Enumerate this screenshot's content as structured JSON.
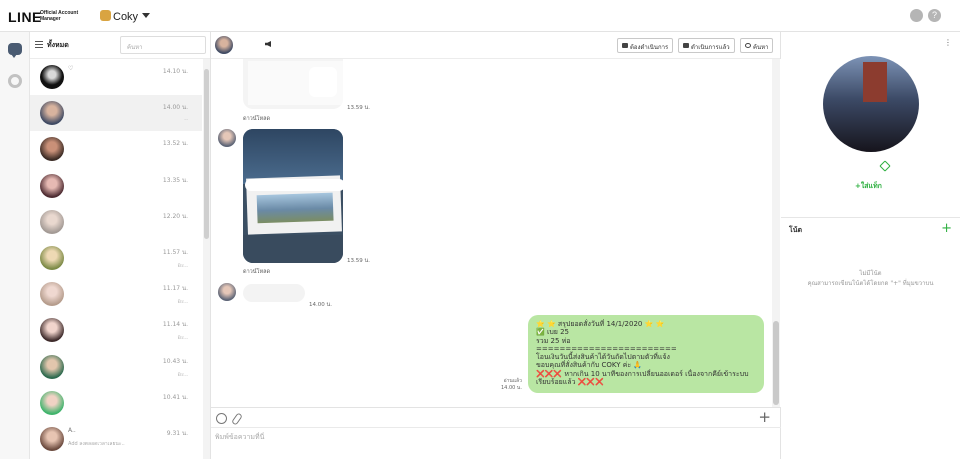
{
  "topbar": {
    "logo": "LINE",
    "logo_sub": "Official Account Manager",
    "account_name": "Coky",
    "user_icon": "user-icon",
    "help_icon": "help-icon",
    "help_glyph": "?"
  },
  "rail": {
    "chat_icon": "chat-icon",
    "settings_icon": "gear-icon"
  },
  "chat_list": {
    "filter_label": "ทั้งหมด",
    "search_placeholder": "ค้นหา",
    "items": [
      {
        "time": "14.10 น.",
        "name": "♡",
        "preview": ""
      },
      {
        "time": "14.00 น.",
        "name": "",
        "preview": ".."
      },
      {
        "time": "13.52 น.",
        "name": "",
        "preview": ""
      },
      {
        "time": "13.35 น.",
        "name": "",
        "preview": ""
      },
      {
        "time": "12.20 น.",
        "name": "",
        "preview": ""
      },
      {
        "time": "11.57 น.",
        "name": "",
        "preview": "อะ.."
      },
      {
        "time": "11.17 น.",
        "name": "",
        "preview": "อะ.."
      },
      {
        "time": "11.14 น.",
        "name": "",
        "preview": "อะ.."
      },
      {
        "time": "10.43 น.",
        "name": "",
        "preview": "อะ.."
      },
      {
        "time": "10.41 น.",
        "name": "",
        "preview": ""
      },
      {
        "time": "9.31 น.",
        "name": "A..",
        "preview": "Add ลงตลอดเวลาเลยนะ.."
      }
    ]
  },
  "chat": {
    "buttons": {
      "todo": "ต้องดำเนินการ",
      "done": "ดำเนินการแล้ว",
      "search": "ค้นหา"
    },
    "messages": {
      "img1_time": "13.59 น.",
      "img1_caption": "ดาวน์โหลด",
      "img2_time": "13.59 น.",
      "img2_caption": "ดาวน์โหลด",
      "text_time": "14.00 น.",
      "read_label": "อ่านแล้ว",
      "read_time": "14.00 น."
    },
    "summary_lines": [
      "⭐ ⭐ สรุปยอดสั่งวันที่ 14/1/2020 ⭐ ⭐",
      "✅ เบย 25",
      "รวม 25 ห่อ",
      "========================",
      "โอนเงินวันนี้ส่งสินค้าได้วันถัดไปตามตัวที่แจ้ง",
      "ขอบคุณที่สั่งสินค้ากับ COKY ค่ะ 🙏",
      "❌❌❌ หากเกิน 10 นาทีของการเปลี่ยนออเดอร์ เนื่องจากคีย์เข้าระบบ",
      "เรียบร้อยแล้ว ❌❌❌"
    ],
    "composer_placeholder": "พิมพ์ข้อความที่นี่",
    "plus_glyph": "+"
  },
  "info_panel": {
    "more_glyph": "⋮",
    "add_tag": "+ใส่แท็ก",
    "note_title": "โน้ต",
    "note_plus": "+",
    "note_empty_1": "ไม่มีโน้ต",
    "note_empty_2": "คุณสามารถเขียนโน้ตได้โดยกด \"+\" ที่มุมขวาบน"
  }
}
